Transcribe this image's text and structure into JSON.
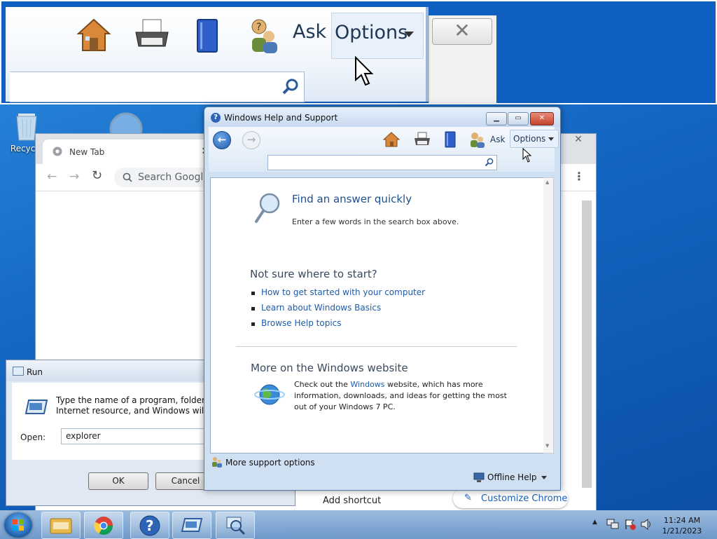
{
  "magnifier": {
    "ask_label": "Ask",
    "options_label": "Options",
    "close_glyph": "✕"
  },
  "desktop": {
    "recycle_bin_label": "Recycle"
  },
  "chrome": {
    "tab_title": "New Tab",
    "omnibox_placeholder": "Search Google",
    "customize_label": "Customize Chrome",
    "add_shortcut_label": "Add shortcut"
  },
  "help": {
    "window_title": "Windows Help and Support",
    "ask_label": "Ask",
    "options_label": "Options",
    "search_placeholder": "",
    "find_title": "Find an answer quickly",
    "find_subtitle": "Enter a few words in the search box above.",
    "not_sure_heading": "Not sure where to start?",
    "links": [
      "How to get started with your computer",
      "Learn about Windows Basics",
      "Browse Help topics"
    ],
    "more_heading": "More on the Windows website",
    "more_text_before": "Check out the ",
    "more_text_link": "Windows",
    "more_text_after": " website, which has more information, downloads, and ideas for getting the most out of your Windows 7 PC.",
    "more_support_label": "More support options",
    "offline_help_label": "Offline Help"
  },
  "run": {
    "title": "Run",
    "description": "Type the name of a program, folder, document, or Internet resource, and Windows will open it for you.",
    "open_label": "Open:",
    "open_value": "explorer",
    "ok_label": "OK",
    "cancel_label": "Cancel"
  },
  "taskbar": {
    "time": "11:24 AM",
    "date": "1/21/2023"
  },
  "colors": {
    "link": "#1f5ba9",
    "heading": "#1f4f8b",
    "desktop": "#1466c2"
  }
}
